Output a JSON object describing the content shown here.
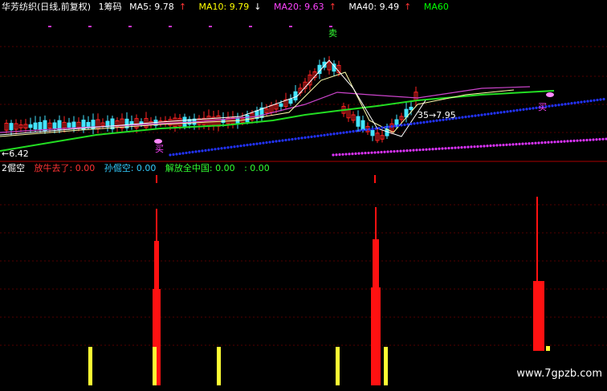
{
  "header": {
    "stock": "华芳纺织(日线,前复权)",
    "chip": "1筹码",
    "ma5": "MA5: 9.78",
    "ma10": "MA10: 9.79",
    "ma20": "MA20: 9.63",
    "ma40": "MA40: 9.49",
    "ma60": "MA60",
    "arrow_up": "↑",
    "arrow_down": "↓",
    "colors": {
      "ma5": "#ffffff",
      "ma10": "#ffff00",
      "ma20": "#ff00ff",
      "ma40": "#ffffff",
      "ma60": "#00ff00",
      "up": "#ff3333",
      "down": "#ffffff",
      "stock": "#ffffff"
    }
  },
  "price_labels": {
    "low": "←6.42",
    "mid": "35→7.95",
    "sell": "卖",
    "buy1": "买",
    "buy2": "买"
  },
  "indicator": {
    "name": "2倔空",
    "item1": "放牛去了: 0.00",
    "item2": "孙倔空: 0.00",
    "item3": "解放全中国: 0.00",
    "item4": ": 0.00",
    "colors": {
      "name": "#ffffff",
      "item1": "#ff3333",
      "item2": "#33ccff",
      "item3": "#33ff33",
      "item4": "#33ff33"
    }
  },
  "watermark": "www.7gpzb.com",
  "theme": {
    "bg": "#000000",
    "bull": "#ff2222",
    "bear": "#44e5ff",
    "grid": "#550000",
    "blue_dots": "#2233ff",
    "magenta_dots": "#dd33ff",
    "green_line": "#22dd22",
    "yellow_bar": "#ffff33",
    "red_bar": "#ff1111"
  }
}
